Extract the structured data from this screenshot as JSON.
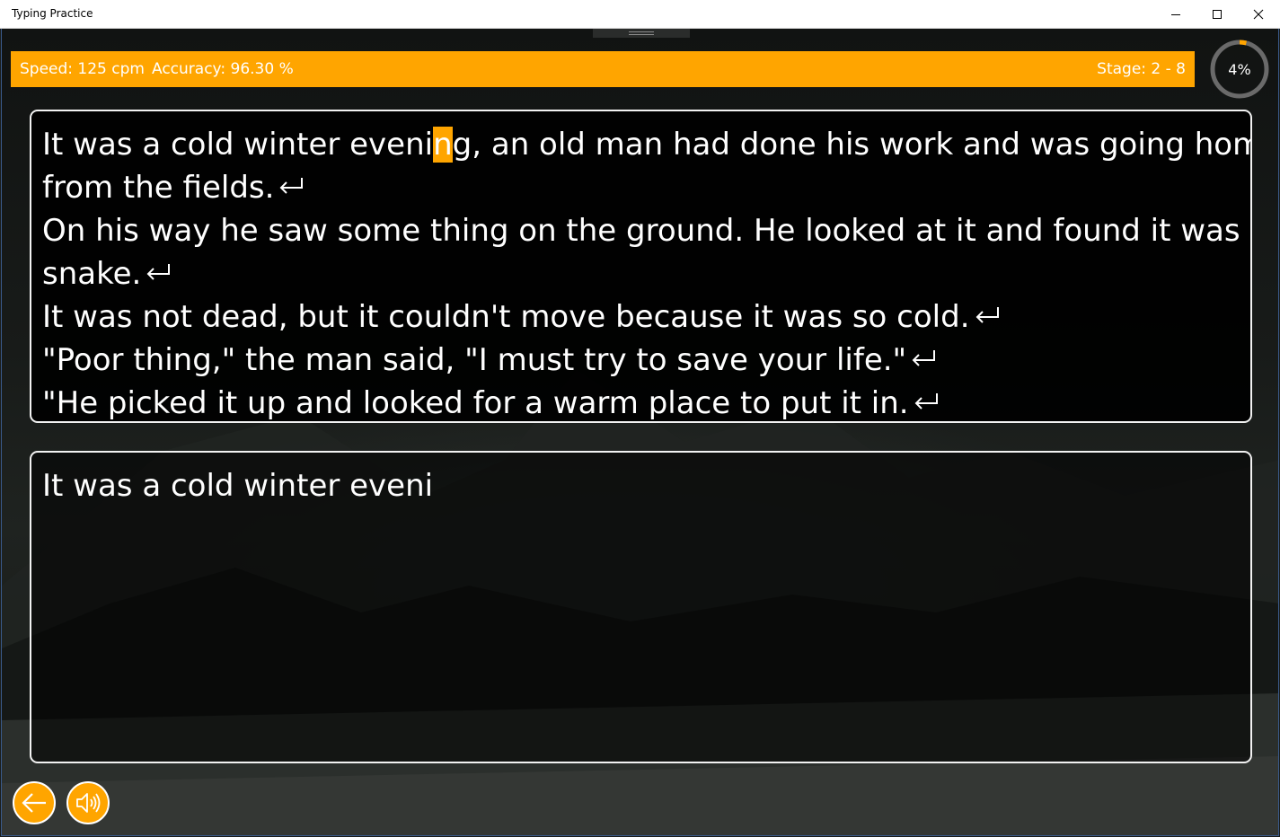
{
  "window": {
    "title": "Typing Practice"
  },
  "stats": {
    "speed": "Speed: 125 cpm",
    "accuracy": "Accuracy: 96.30 %",
    "stage": "Stage: 2 - 8"
  },
  "progress": {
    "label": "4%",
    "fraction": 0.04
  },
  "source": {
    "lines": [
      {
        "before": "It was a cold winter eveni",
        "cursor": "n",
        "after": "g, an old man had done his work and was going home",
        "enter": false
      },
      {
        "text": "from the fields.",
        "enter": true
      },
      {
        "text": "On his way he saw some thing on the ground. He looked at it and found it was a",
        "enter": false
      },
      {
        "text": "snake.",
        "enter": true
      },
      {
        "text": "It was not dead, but it couldn't move because it was so cold.",
        "enter": true
      },
      {
        "text": "\"Poor thing,\" the man said, \"I must try to save your life.\"",
        "enter": true
      },
      {
        "text": "\"He picked it up and looked for a warm place to put it in.",
        "enter": true
      }
    ]
  },
  "input": {
    "typed": "It was a cold winter eveni"
  },
  "buttons": {
    "back_icon": "arrow-left-icon",
    "sound_icon": "speaker-icon"
  },
  "colors": {
    "accent": "#ffa500",
    "text": "#ffffff",
    "panel_border": "#f2f2f2"
  }
}
